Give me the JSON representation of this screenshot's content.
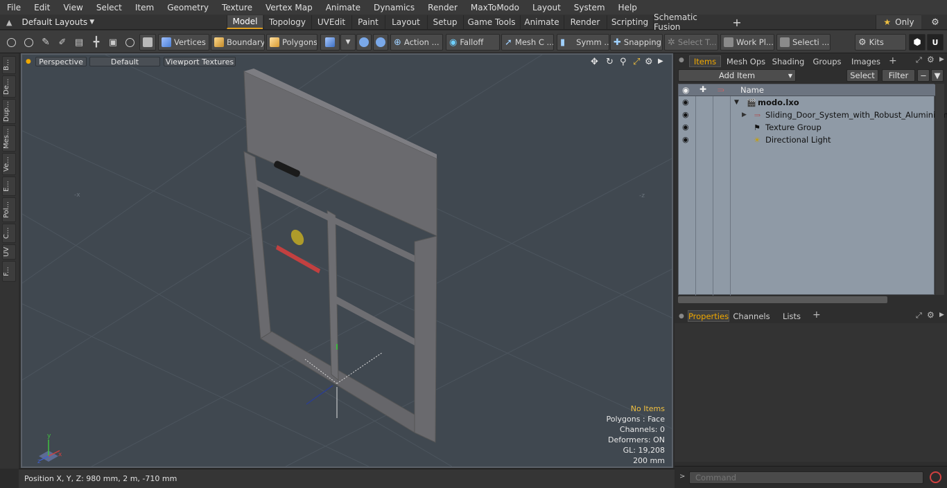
{
  "menu": [
    "File",
    "Edit",
    "View",
    "Select",
    "Item",
    "Geometry",
    "Texture",
    "Vertex Map",
    "Animate",
    "Dynamics",
    "Render",
    "MaxToModo",
    "Layout",
    "System",
    "Help"
  ],
  "layouts_label": "Default Layouts",
  "tabs": [
    "Model",
    "Topology",
    "UVEdit",
    "Paint",
    "Layout",
    "Setup",
    "Game Tools",
    "Animate",
    "Render",
    "Scripting",
    "Schematic Fusion"
  ],
  "active_tab": "Model",
  "only_label": "Only",
  "toolbar": {
    "vertices": "Vertices",
    "boundary": "Boundary",
    "polygons": "Polygons",
    "action": "Action ...",
    "falloff": "Falloff",
    "mesh": "Mesh C ...",
    "symm": "Symm ...",
    "snapping": "Snapping",
    "select_t": "Select T...",
    "workpl": "Work Pl...",
    "selecti": "Selecti ...",
    "kits": "Kits"
  },
  "left_tabs": [
    "B...",
    "De...",
    "Dup...",
    "Mes...",
    "Ve...",
    "E...",
    "Pol...",
    "C...",
    "UV",
    "F..."
  ],
  "viewport": {
    "view": "Perspective",
    "shading": "Default",
    "textures": "Viewport Textures",
    "info": [
      "No Items",
      "Polygons : Face",
      "Channels: 0",
      "Deformers: ON",
      "GL: 19,208",
      "200 mm"
    ]
  },
  "status": "Position X, Y, Z:   980 mm, 2 m, -710 mm",
  "panel": {
    "tabs": [
      "Items",
      "Mesh Ops",
      "Shading",
      "Groups",
      "Images"
    ],
    "add_item": "Add Item",
    "select": "Select",
    "filter": "Filter",
    "name_header": "Name",
    "items": [
      {
        "label": "modo.lxo",
        "bold": true
      },
      {
        "label": "Sliding_Door_System_with_Robust_Aluminium_ ...",
        "bold": false
      },
      {
        "label": "Texture Group",
        "bold": false
      },
      {
        "label": "Directional Light",
        "bold": false
      }
    ],
    "bottom_tabs": [
      "Properties",
      "Channels",
      "Lists"
    ],
    "command_placeholder": "Command"
  },
  "colors": {
    "accent": "#f0a800",
    "viewport_bg": "#404850"
  }
}
